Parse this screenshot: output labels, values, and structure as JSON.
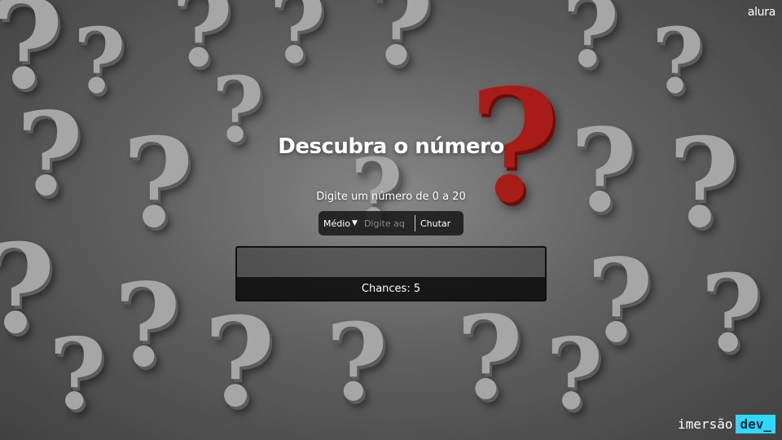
{
  "brand": {
    "logo": "alura",
    "tagline_word": "imersão",
    "tagline_badge": "dev_"
  },
  "game": {
    "title": "Descubra o número",
    "subtitle": "Digite um número de 0 a 20",
    "difficulty": "Médio",
    "input_placeholder": "Digite aq",
    "guess_button": "Chutar",
    "chances_label": "Chances: 5"
  },
  "colors": {
    "accent_red": "#c0201c",
    "dev_badge": "#2ed8ff"
  }
}
